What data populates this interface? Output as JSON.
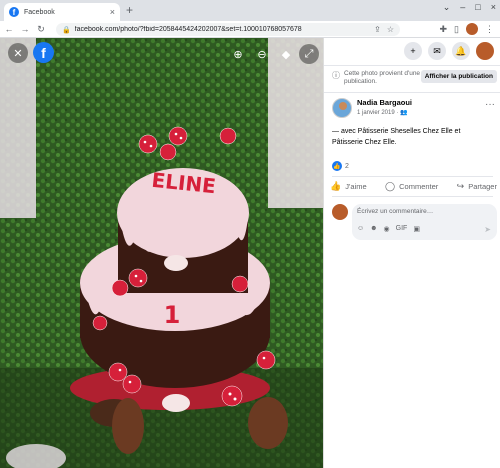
{
  "browser": {
    "tab_title": "Facebook",
    "tab_favicon": "f",
    "tab_close": "×",
    "new_tab": "+",
    "window_controls": [
      "⌄",
      "–",
      "□",
      "×"
    ],
    "nav": {
      "back": "←",
      "forward": "→",
      "reload": "↻"
    },
    "url": "facebook.com/photo/?fbid=2058445424202007&set=t.100010768057678",
    "omnibox_icons": {
      "share": "⇪",
      "star": "☆"
    },
    "toolbar_icons": {
      "extensions": "✚",
      "sidebar": "▯",
      "menu": "⋮"
    }
  },
  "viewer": {
    "close": "✕",
    "logo": "f",
    "zoom_in": "⊕",
    "zoom_out": "⊖",
    "tag": "◆",
    "fullscreen": "⤢",
    "photo_text": "ELINE",
    "tier_number": "1"
  },
  "panel": {
    "top_icons": {
      "plus": "+",
      "messenger": "✉",
      "notifications": "🔔",
      "account": ""
    },
    "notice_text": "Cette photo provient d'une publication.",
    "notice_button": "Afficher la publication",
    "author_name": "Nadia Bargaoui",
    "post_date": "1 janvier 2019 · 👥",
    "more": "···",
    "caption": "— avec Pâtisserie Sheselles Chez Elle et Pâtisserie Chez Elle.",
    "reaction_count": "2",
    "actions": {
      "like": "J'aime",
      "comment": "Commenter",
      "share": "Partager"
    },
    "comment_placeholder": "Écrivez un commentaire…",
    "comment_icons": [
      "☺",
      "☻",
      "◉",
      "GIF",
      "▣"
    ],
    "send": "➤"
  },
  "colors": {
    "facebook_blue": "#1877f2",
    "cake_pink": "#f2d6dc",
    "cake_chocolate": "#3a1a12",
    "mushroom_red": "#d6203a",
    "hedge_green": "#2f5a22"
  }
}
